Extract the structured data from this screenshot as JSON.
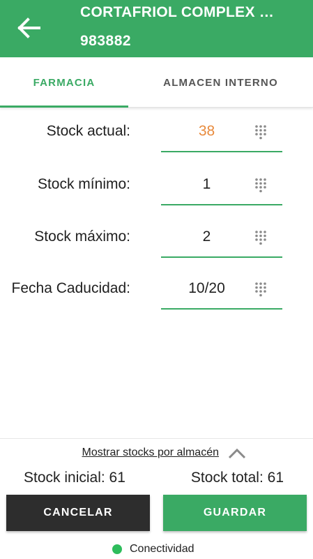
{
  "header": {
    "title": "CORTAFRIOL COMPLEX …",
    "subtitle": "983882"
  },
  "tabs": [
    {
      "label": "FARMACIA",
      "active": true
    },
    {
      "label": "ALMACEN INTERNO",
      "active": false
    }
  ],
  "fields": [
    {
      "label": "Stock actual:",
      "value": "38"
    },
    {
      "label": "Stock mínimo:",
      "value": "1"
    },
    {
      "label": "Stock máximo:",
      "value": "2"
    },
    {
      "label": "Fecha Caducidad:",
      "value": "10/20"
    }
  ],
  "footer": {
    "toggle_label": "Mostrar stocks por almacén",
    "stock_inicial": "Stock inicial: 61",
    "stock_total": "Stock total: 61",
    "cancel_label": "CANCELAR",
    "save_label": "GUARDAR",
    "status_label": "Conectividad"
  },
  "colors": {
    "primary": "#3aaa64",
    "accent_value": "#e88a3c",
    "dark_button": "#2d2d2d",
    "status_ok": "#2ebd5c"
  },
  "icons": {
    "back": "arrow-back-icon",
    "keypad": "dialpad-icon",
    "expand": "chevron-up-icon"
  }
}
